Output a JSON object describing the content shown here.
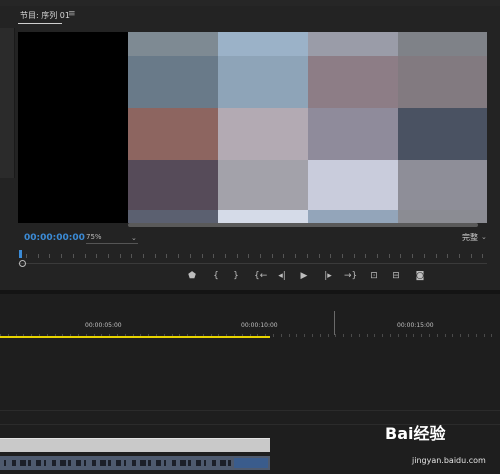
{
  "monitor": {
    "tab_title": "节目: 序列 01",
    "menu_icon": "≡",
    "timecode": "00:00:00:00",
    "zoom": "75%",
    "quality": "完整"
  },
  "mosaic_colors": [
    [
      "#7e8a93",
      "#9bb2c8",
      "#9a9ca8",
      "#7f8288"
    ],
    [
      "#697a89",
      "#8ea4b8",
      "#8d7d86",
      "#827a80"
    ],
    [
      "#8d6560",
      "#b3aab3",
      "#8f8b9b",
      "#4a5262"
    ],
    [
      "#564b59",
      "#a3a2aa",
      "#c9ccdc",
      "#8e8e98"
    ],
    [
      "#5b6070",
      "#d5dbe8",
      "#93a5ba",
      "#8b8c93"
    ]
  ],
  "transport": {
    "icons": [
      "marker-icon",
      "mark-in-icon",
      "mark-out-icon",
      "go-to-in-icon",
      "step-back-icon",
      "play-icon",
      "step-forward-icon",
      "go-to-out-icon",
      "lift-icon",
      "extract-icon",
      "export-frame-icon"
    ],
    "glyphs": [
      "⬟",
      "{",
      "}",
      "{←",
      "◂|",
      "▶",
      "|▸",
      "→}",
      "⊡",
      "⊟",
      "◙"
    ]
  },
  "timeline": {
    "ruler_labels": [
      "00:00:05:00",
      "00:00:10:00",
      "00:00:15:00"
    ]
  },
  "watermark": {
    "brand": "Bai经验",
    "site": "jingyan.baidu.com"
  },
  "colors": {
    "accent_timecode": "#3b8bd6",
    "work_area": "#e8d400"
  }
}
